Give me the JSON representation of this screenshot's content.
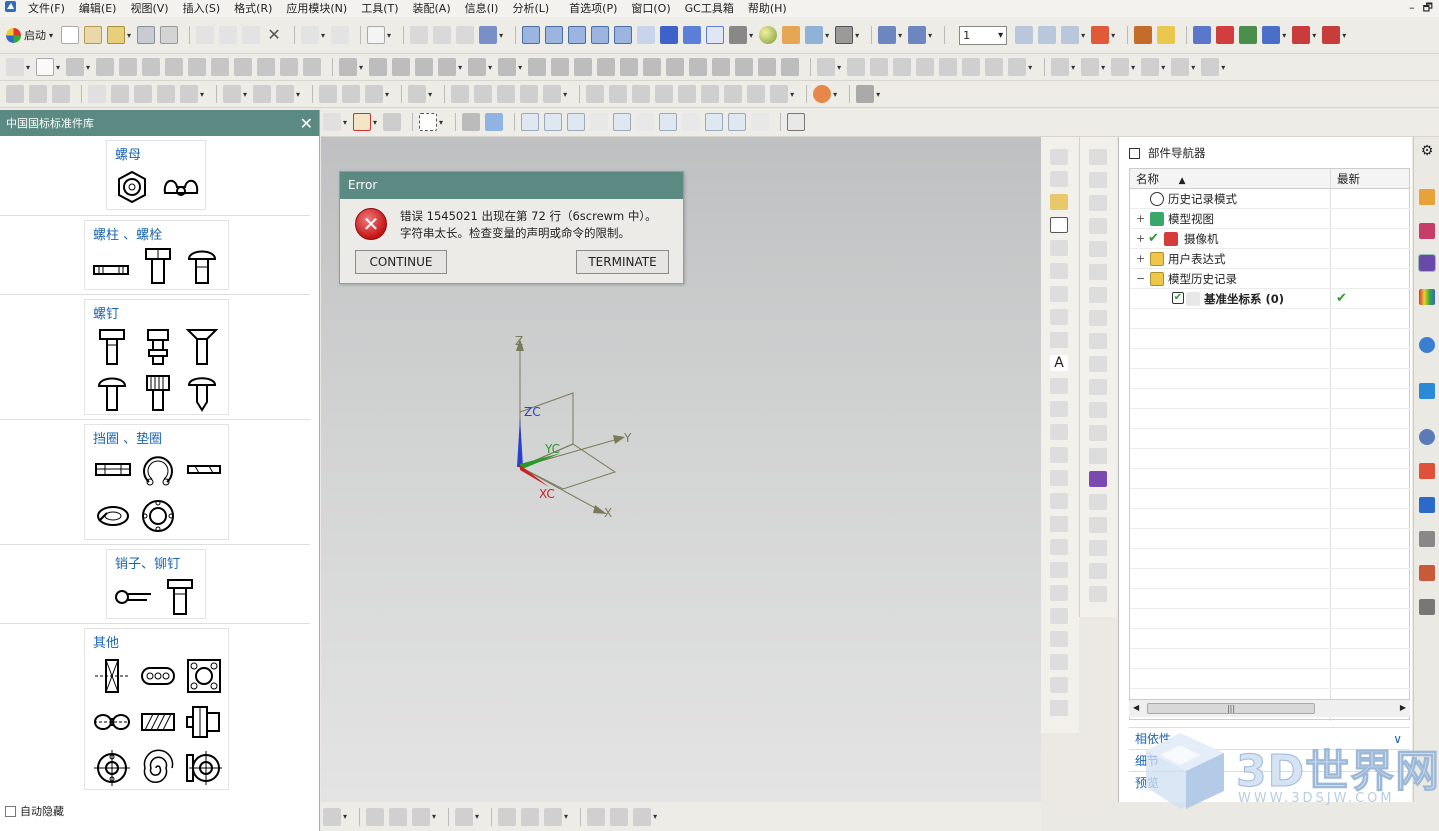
{
  "menubar": {
    "items": [
      "文件(F)",
      "编辑(E)",
      "视图(V)",
      "插入(S)",
      "格式(R)",
      "应用模块(N)",
      "工具(T)",
      "装配(A)",
      "信息(I)",
      "分析(L)",
      "首选项(P)",
      "窗口(O)",
      "GC工具箱",
      "帮助(H)"
    ],
    "window_controls": [
      "–",
      "🗗"
    ]
  },
  "toolbar": {
    "start_label": "启动",
    "layer_combo_value": "1"
  },
  "library": {
    "title": "中国国标标准件库",
    "close_symbol": "✕",
    "categories": [
      {
        "name": "螺母"
      },
      {
        "name": "螺柱 、螺栓"
      },
      {
        "name": "螺钉"
      },
      {
        "name": "挡圈 、垫圈"
      },
      {
        "name": "销子、铆钉"
      },
      {
        "name": "其他"
      }
    ],
    "auto_hide_label": "自动隐藏"
  },
  "error_dialog": {
    "title": "Error",
    "message_line1": "错误 1545021 出现在第 72 行（6screwm 中）。",
    "message_line2": "字符串太长。检查变量的声明或命令的限制。",
    "continue_label": "CONTINUE",
    "terminate_label": "TERMINATE",
    "icon": "error-x-icon"
  },
  "viewport": {
    "axes": {
      "z": "Z",
      "zc": "ZC",
      "yc": "YC",
      "y": "Y",
      "xc": "XC",
      "x": "X"
    }
  },
  "part_navigator": {
    "title": "部件导航器",
    "col_name": "名称",
    "col_latest": "最新",
    "rows": [
      {
        "label": "历史记录模式"
      },
      {
        "label": "模型视图"
      },
      {
        "label": "摄像机"
      },
      {
        "label": "用户表达式"
      },
      {
        "label": "模型历史记录"
      },
      {
        "label": "基准坐标系 (0)",
        "latest": "✔"
      }
    ],
    "footer_1": "相依性",
    "footer_2": "细节",
    "footer_3": "预览"
  },
  "watermark": {
    "text": "3D世界网",
    "url": "WWW.3DSJW.COM"
  },
  "colors": {
    "panel_header": "#5b8a82",
    "link_blue": "#1a64b4",
    "error_red": "#c41616"
  }
}
